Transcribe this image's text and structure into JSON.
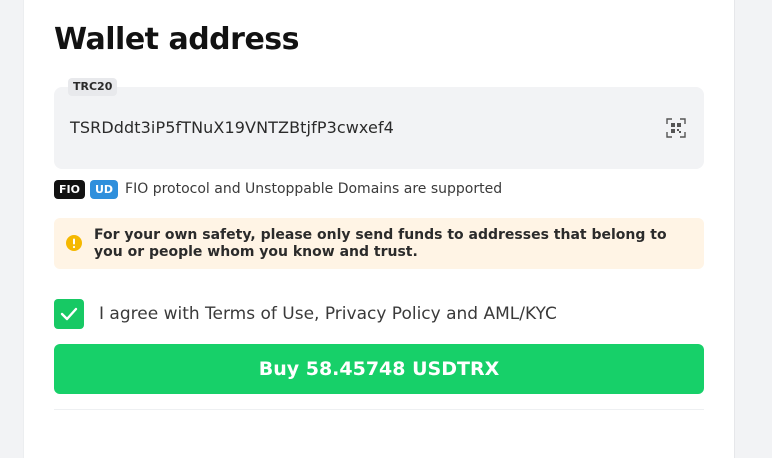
{
  "wallet": {
    "title": "Wallet address",
    "network": "TRC20",
    "address": "TSRDddt3iP5fTNuX19VNTZBtjfP3cwxef4",
    "scan_icon": "qr-scan-icon"
  },
  "support": {
    "fio_badge": "FIO",
    "ud_badge": "UD",
    "text": "FIO protocol and Unstoppable Domains are supported"
  },
  "warning": {
    "icon": "warning-icon",
    "text": "For your own safety, please only send funds to addresses that belong to you or people whom you know and trust."
  },
  "agreement": {
    "checked": true,
    "text": "I agree with Terms of Use, Privacy Policy and AML/KYC"
  },
  "buy_button": {
    "label": "Buy 58.45748 USDTRX"
  },
  "colors": {
    "accent_green": "#17d069",
    "ud_blue": "#2f8fdc",
    "warning_bg": "#fff4e5",
    "warning_icon": "#f5b800"
  }
}
